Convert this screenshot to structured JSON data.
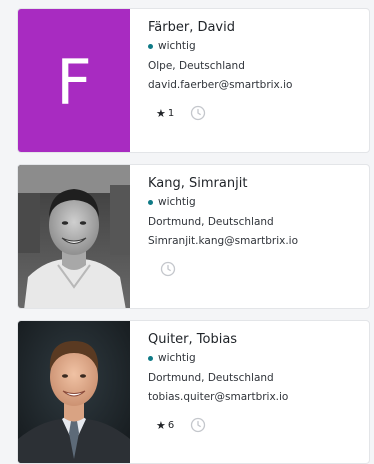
{
  "contacts": [
    {
      "avatar_letter": "F",
      "avatar_color": "#a82bc1",
      "name": "Färber, David",
      "tag": "wichtig",
      "location": "Olpe, Deutschland",
      "email": "david.faerber@smartbrix.io",
      "rating": "1"
    },
    {
      "name": "Kang, Simranjit",
      "tag": "wichtig",
      "location": "Dortmund, Deutschland",
      "email": "Simranjit.kang@smartbrix.io"
    },
    {
      "name": "Quiter, Tobias",
      "tag": "wichtig",
      "location": "Dortmund, Deutschland",
      "email": "tobias.quiter@smartbrix.io",
      "rating": "6"
    }
  ],
  "colors": {
    "tag_dot": "#0f7a86",
    "card_border": "#e3e5e8",
    "page_bg": "#f4f5f7"
  },
  "icons": {
    "rating": "star-icon",
    "history": "clock-icon"
  }
}
